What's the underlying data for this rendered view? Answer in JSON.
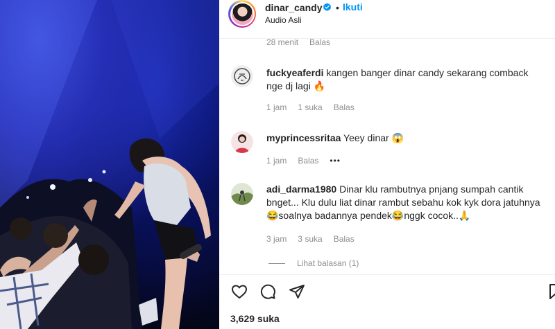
{
  "post": {
    "username": "dinar_candy",
    "follow_label": "Ikuti",
    "separator": "•",
    "audio": "Audio Asli",
    "likes": "3,629 suka"
  },
  "comments": {
    "prev_meta": {
      "time": "28 menit",
      "reply": "Balas"
    },
    "items": [
      {
        "user": "fuckyeaferdi",
        "text": "kangen banger dinar candy sekarang comback nge dj lagi 🔥",
        "time": "1 jam",
        "likes": "1 suka",
        "reply": "Balas"
      },
      {
        "user": "myprincessritaa",
        "text": "Yeey dinar 😱",
        "time": "1 jam",
        "reply": "Balas",
        "more": "•••"
      },
      {
        "user": "adi_darma1980",
        "text": "Dinar klu rambutnya pnjang sumpah cantik bnget... Klu dulu liat dinar rambut sebahu kok kyk dora jatuhnya😂soalnya badannya pendek😂nggk cocok..🙏",
        "time": "3 jam",
        "likes": "3 suka",
        "reply": "Balas"
      }
    ],
    "view_replies": "Lihat balasan (1)"
  },
  "icons": [
    "heart-icon",
    "comment-icon",
    "share-icon",
    "bookmark-icon",
    "verified-icon"
  ],
  "colors": {
    "accent": "#0095f6",
    "muted": "#8e8e8e",
    "text": "#262626"
  }
}
